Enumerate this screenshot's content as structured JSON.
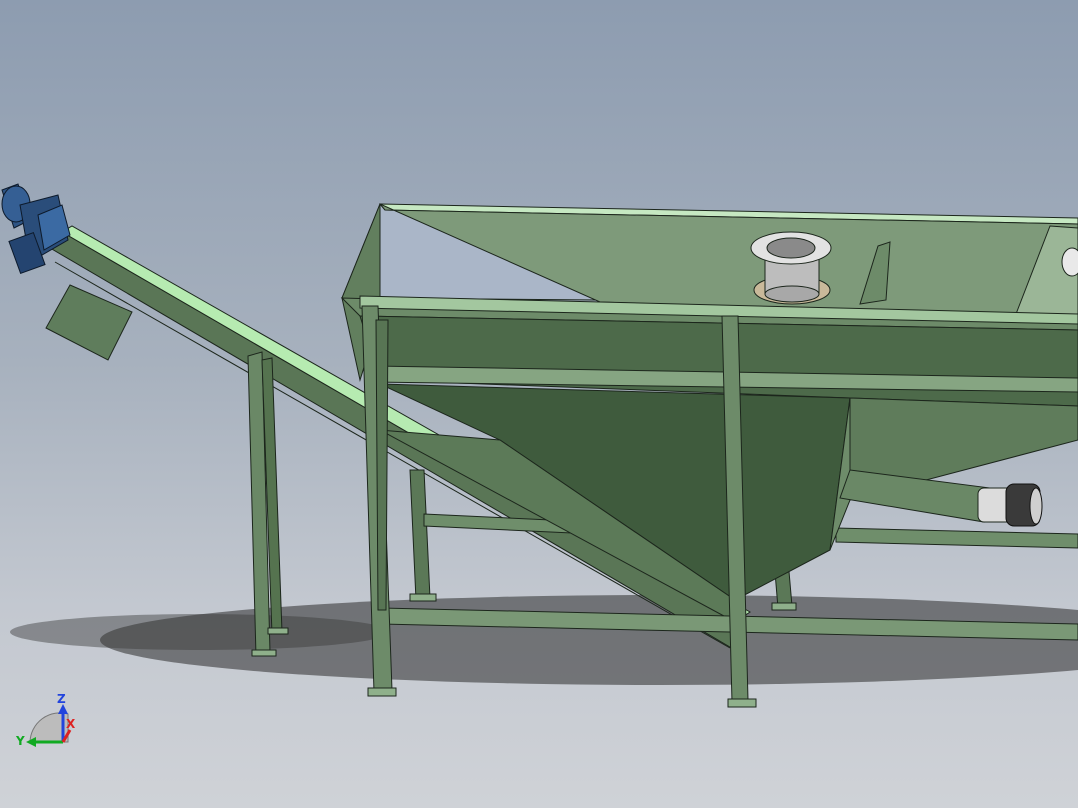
{
  "app": {
    "name": ""
  },
  "model": {
    "frame_color": "#5e7a5a",
    "frame_dark": "#3d5a3c",
    "frame_light": "#a9e0a5",
    "motor_color": "#2a4d7a",
    "steel_color": "#c8c8c8"
  },
  "triad": {
    "z_label": "Z",
    "y_label": "Y",
    "x_label": "X",
    "z_color": "#2244dd",
    "y_color": "#11aa22",
    "x_color": "#dd2222"
  }
}
